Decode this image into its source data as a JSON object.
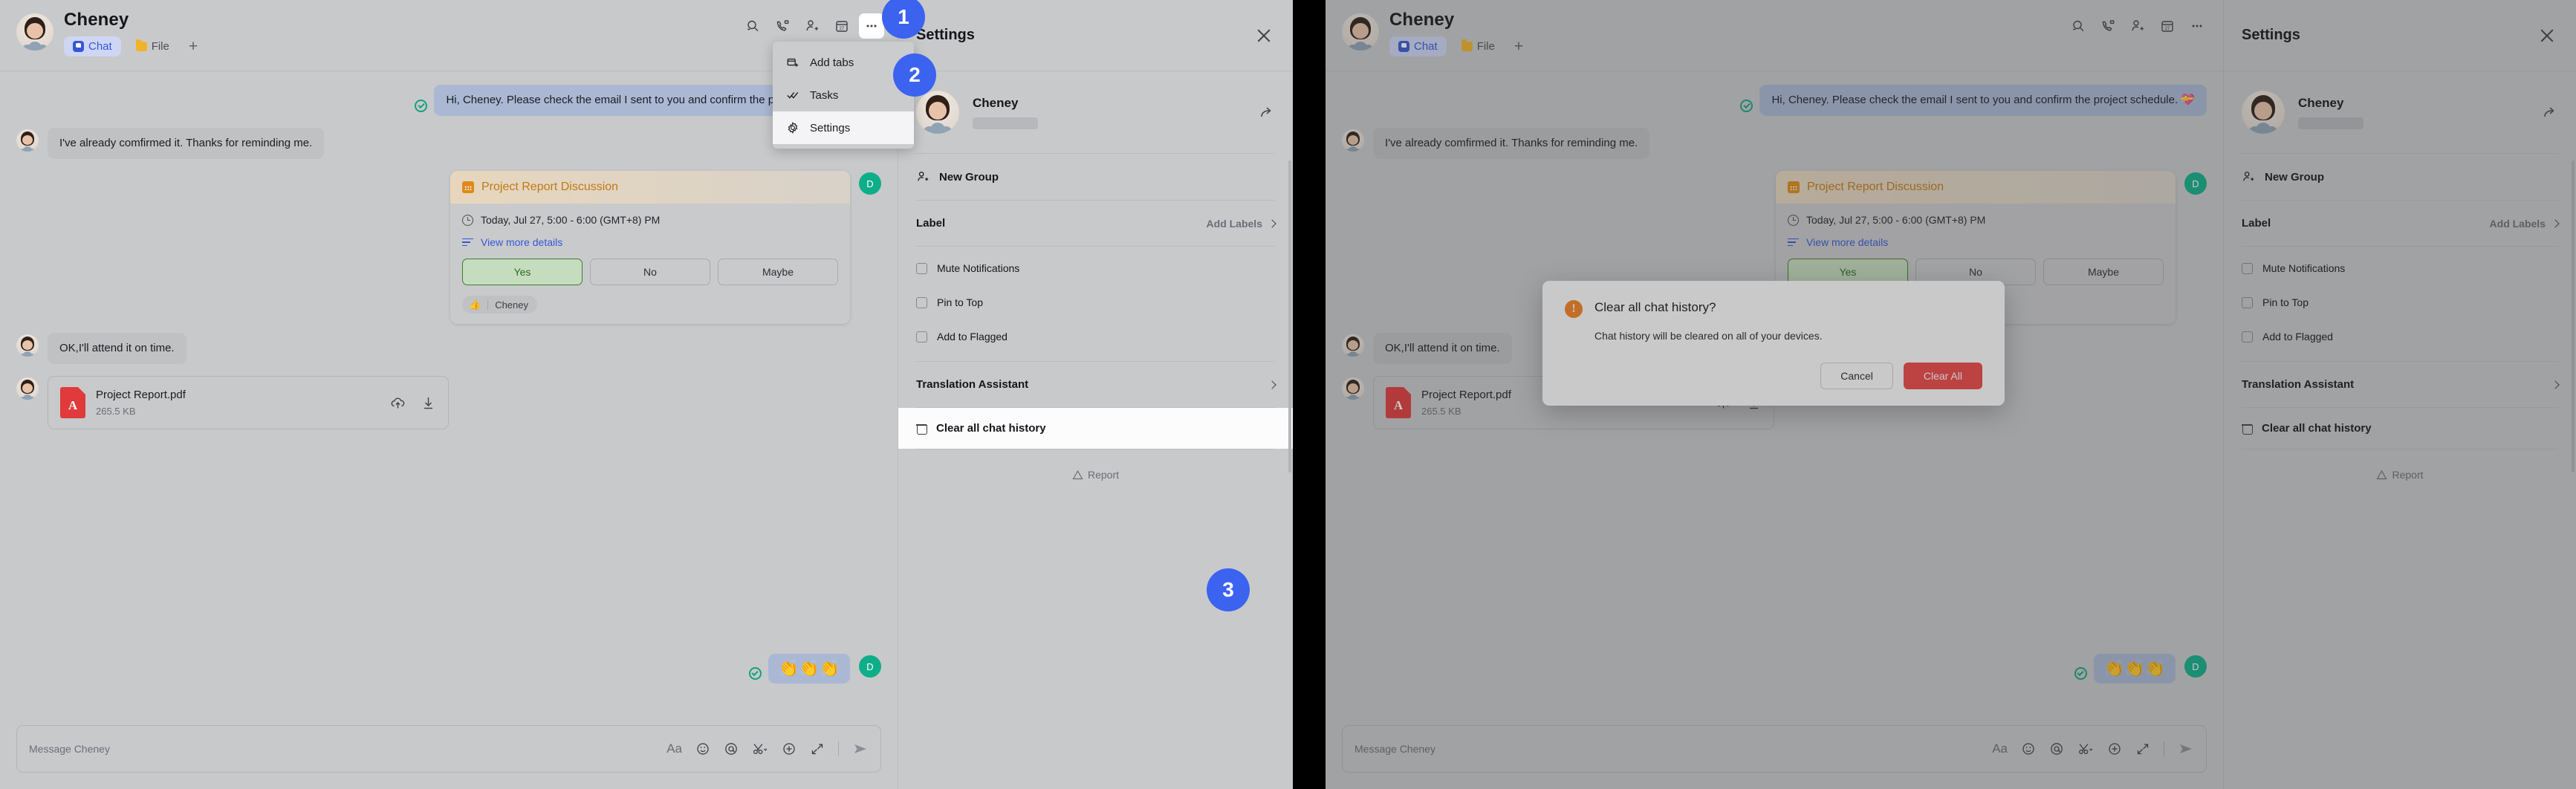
{
  "chat": {
    "contact_name": "Cheney",
    "tabs": [
      {
        "label": "Chat",
        "icon": "chat-icon",
        "active": true
      },
      {
        "label": "File",
        "icon": "folder-icon",
        "active": false
      }
    ],
    "add_tab_label": "+",
    "header_actions": [
      {
        "name": "search-icon"
      },
      {
        "name": "video-call-icon"
      },
      {
        "name": "add-member-icon"
      },
      {
        "name": "calendar-icon"
      },
      {
        "name": "more-options-icon"
      }
    ],
    "messages": [
      {
        "direction": "out",
        "text": "Hi, Cheney. Please check the email I sent to you and confirm the project schedule.",
        "emoji": "💝",
        "status": "delivered"
      },
      {
        "direction": "in",
        "text": "I've already comfirmed it. Thanks for reminding me."
      },
      {
        "direction": "in",
        "text": "OK,I'll attend it on time."
      }
    ],
    "meeting_card": {
      "title": "Project Report Discussion",
      "time": "Today, Jul 27, 5:00 - 6:00 (GMT+8) PM",
      "details_link": "View more details",
      "rsvp": [
        {
          "label": "Yes",
          "selected": true
        },
        {
          "label": "No",
          "selected": false
        },
        {
          "label": "Maybe",
          "selected": false
        }
      ],
      "reaction": {
        "emoji": "👍",
        "name": "Cheney"
      },
      "sender_initial": "D"
    },
    "file_card": {
      "file_name": "Project Report.pdf",
      "file_size": "265.5 KB",
      "file_type": "pdf",
      "actions": [
        {
          "name": "save-to-cloud-icon"
        },
        {
          "name": "download-icon"
        }
      ]
    },
    "emoji_message": {
      "emoji": "👏👏👏",
      "sender_initial": "D"
    },
    "composer": {
      "placeholder": "Message Cheney",
      "tools": [
        {
          "name": "format-text-icon",
          "glyph": "Aa"
        },
        {
          "name": "emoji-icon"
        },
        {
          "name": "mention-icon"
        },
        {
          "name": "screenshot-icon"
        },
        {
          "name": "attach-plus-icon"
        },
        {
          "name": "expand-icon"
        }
      ],
      "send_label": "send-icon"
    }
  },
  "dropdown": {
    "items": [
      {
        "label": "Add tabs",
        "icon": "add-tabs-icon",
        "highlighted": false
      },
      {
        "label": "Tasks",
        "icon": "tasks-icon",
        "highlighted": false
      },
      {
        "label": "Settings",
        "icon": "gear-icon",
        "highlighted": true
      }
    ]
  },
  "settings": {
    "title": "Settings",
    "close_label": "close-icon",
    "profile": {
      "name": "Cheney",
      "subtitle_redacted": true,
      "share_icon": "share-icon"
    },
    "new_group": {
      "label": "New Group",
      "icon": "new-group-icon"
    },
    "label_row": {
      "label": "Label",
      "action": "Add Labels"
    },
    "checkboxes": [
      {
        "label": "Mute Notifications",
        "checked": false
      },
      {
        "label": "Pin to Top",
        "checked": false
      },
      {
        "label": "Add to Flagged",
        "checked": false
      }
    ],
    "translation_row": {
      "label": "Translation Assistant"
    },
    "clear_history": {
      "label": "Clear all chat history",
      "icon": "trash-icon"
    },
    "report": {
      "label": "Report",
      "icon": "warning-triangle-icon"
    }
  },
  "modal": {
    "icon": "warning-exclamation-icon",
    "title": "Clear all chat history?",
    "body": "Chat history will be cleared on all of your devices.",
    "cancel_label": "Cancel",
    "confirm_label": "Clear All"
  },
  "step_badges": [
    {
      "number": "1"
    },
    {
      "number": "2"
    },
    {
      "number": "3"
    }
  ],
  "colors": {
    "accent_blue": "#3b63f0",
    "danger_red": "#ef4444",
    "warning_orange": "#f58220",
    "link_blue": "#3558d6",
    "outgoing_bubble": "#aab8d4",
    "incoming_bubble": "#c0c1c3",
    "page_bg": "#c8c9cb"
  }
}
